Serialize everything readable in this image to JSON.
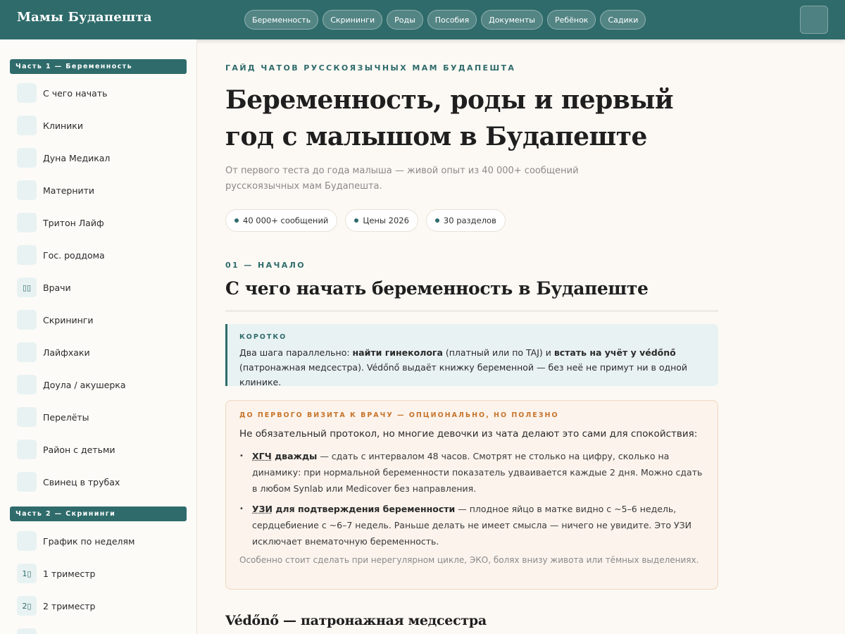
{
  "header": {
    "logo": "Мамы Будапешта",
    "nav": [
      "Беременность",
      "Скрининги",
      "Роды",
      "Пособия",
      "Документы",
      "Ребёнок",
      "Садики"
    ]
  },
  "sidebar": {
    "part1": "Часть 1 — Беременность",
    "part1_items": [
      {
        "icon": "",
        "label": "С чего начать"
      },
      {
        "icon": "",
        "label": "Клиники"
      },
      {
        "icon": "",
        "label": "Дуна Медикал"
      },
      {
        "icon": "",
        "label": "Матернити"
      },
      {
        "icon": "",
        "label": "Тритон Лайф"
      },
      {
        "icon": "",
        "label": "Гос. роддома"
      },
      {
        "icon": "▯▯",
        "label": "Врачи"
      },
      {
        "icon": "",
        "label": "Скрининги"
      },
      {
        "icon": "",
        "label": "Лайфхаки"
      },
      {
        "icon": "",
        "label": "Доула / акушерка"
      },
      {
        "icon": "",
        "label": "Перелёты"
      },
      {
        "icon": "",
        "label": "Район с детьми"
      },
      {
        "icon": "",
        "label": "Свинец в трубах"
      }
    ],
    "part2": "Часть 2 — Скрининги",
    "part2_items": [
      {
        "icon": "",
        "label": "График по неделям"
      },
      {
        "icon": "1▯",
        "label": "1 триместр"
      },
      {
        "icon": "2▯",
        "label": "2 триместр"
      }
    ]
  },
  "main": {
    "eyebrow": "Гайд чатов русскоязычных мам Будапешта",
    "title": "Беременность, роды и первый год с малышом в Будапеште",
    "lead": "От первого теста до года малыша — живой опыт из 40 000+ сообщений русскоязычных мам Будапешта.",
    "stats": [
      "40 000+ сообщений",
      "Цены 2026",
      "30 разделов"
    ],
    "section": {
      "num": "01 — Начало",
      "title": "С чего начать беременность в Будапеште",
      "short_label": "Коротко",
      "short_text": {
        "p1": "Два шага параллельно: ",
        "b1": "найти гинеколога",
        "p2": " (платный или по TAJ) и ",
        "b2": "встать на учёт у védőnő",
        "p3": " (патронажная медсестра). Védőnő выдаёт книжку беременной — без неё не примут ни в одной клинике."
      },
      "optional": {
        "label": "До первого визита к врачу — опционально, но полезно",
        "intro": "Не обязательный протокол, но многие девочки из чата делают это сами для спокойствия:",
        "items": [
          {
            "abbr": "ХГЧ",
            "bold_rest": " дважды",
            "text": " — сдать с интервалом 48 часов. Смотрят не столько на цифру, сколько на динамику: при нормальной беременности показатель удваивается каждые 2 дня. Можно сдать в любом Synlab или Medicover без направления."
          },
          {
            "abbr": "УЗИ",
            "bold_rest": " для подтверждения беременности",
            "text": " — плодное яйцо в матке видно с ~5–6 недель, сердцебиение с ~6–7 недель. Раньше делать не имеет смысла — ничего не увидите. Это УЗИ исключает внематочную беременность."
          }
        ],
        "note": "Особенно стоит сделать при нерегулярном цикле, ЭКО, болях внизу живота или тёмных выделениях."
      }
    },
    "subsection": "Védőnő — патронажная медсестра"
  }
}
